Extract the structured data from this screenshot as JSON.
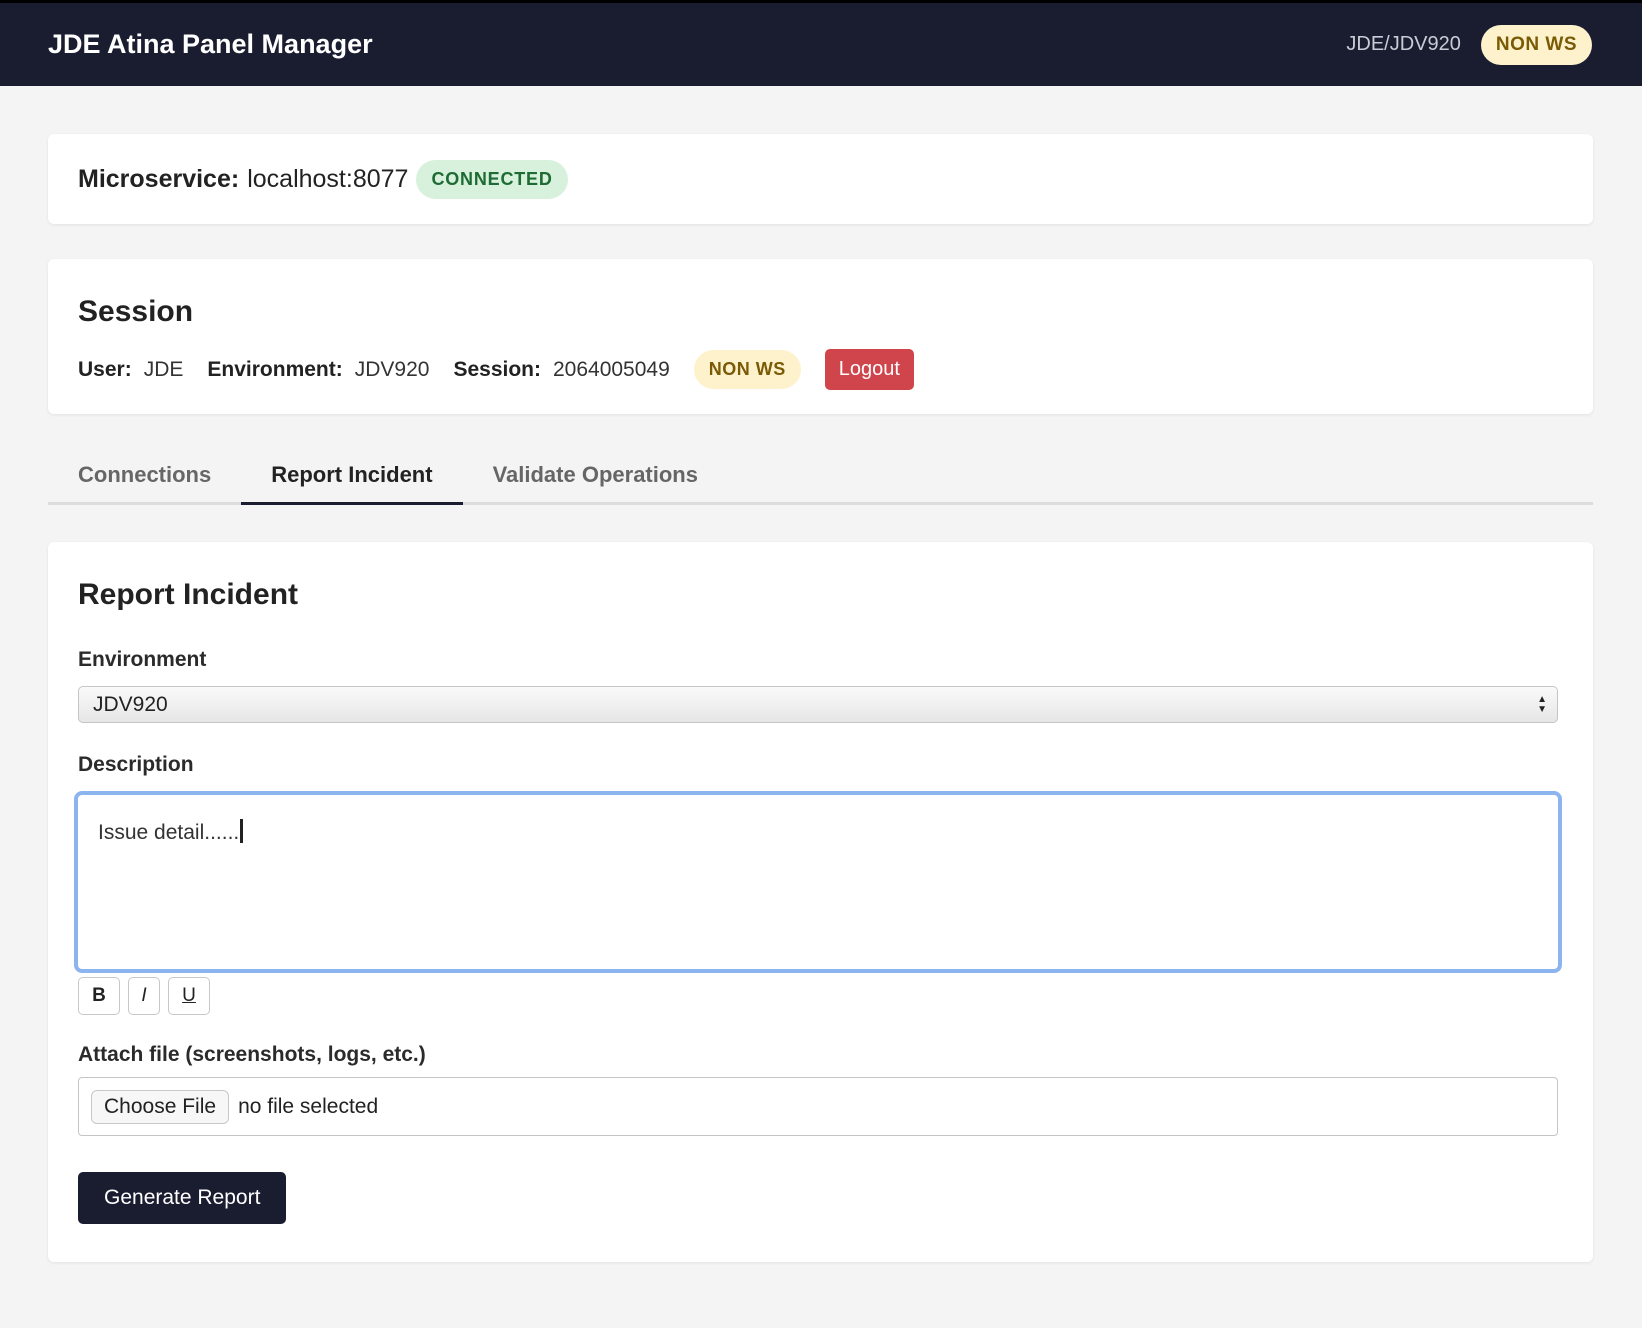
{
  "header": {
    "title": "JDE Atina Panel Manager",
    "env_path": "JDE/JDV920",
    "mode_badge": "NON WS"
  },
  "microservice": {
    "label": "Microservice:",
    "host": "localhost:8077",
    "status": "CONNECTED"
  },
  "session": {
    "title": "Session",
    "user_label": "User:",
    "user": "JDE",
    "environment_label": "Environment:",
    "environment": "JDV920",
    "session_label": "Session:",
    "session_id": "2064005049",
    "mode_badge": "NON WS",
    "logout_label": "Logout"
  },
  "tabs": [
    {
      "label": "Connections",
      "active": false
    },
    {
      "label": "Report Incident",
      "active": true
    },
    {
      "label": "Validate Operations",
      "active": false
    }
  ],
  "report": {
    "title": "Report Incident",
    "environment_label": "Environment",
    "environment_value": "JDV920",
    "description_label": "Description",
    "description_value": "Issue detail......",
    "format_buttons": [
      "B",
      "I",
      "U"
    ],
    "attach_label": "Attach file (screenshots, logs, etc.)",
    "choose_file_label": "Choose File",
    "file_status": "no file selected",
    "generate_label": "Generate Report"
  },
  "colors": {
    "topbar": "#1a1d30",
    "connected_bg": "#d8f1dd",
    "nonws_bg": "#fdf2cc",
    "logout": "#d0454c",
    "focus_ring": "#8cb4ee"
  }
}
